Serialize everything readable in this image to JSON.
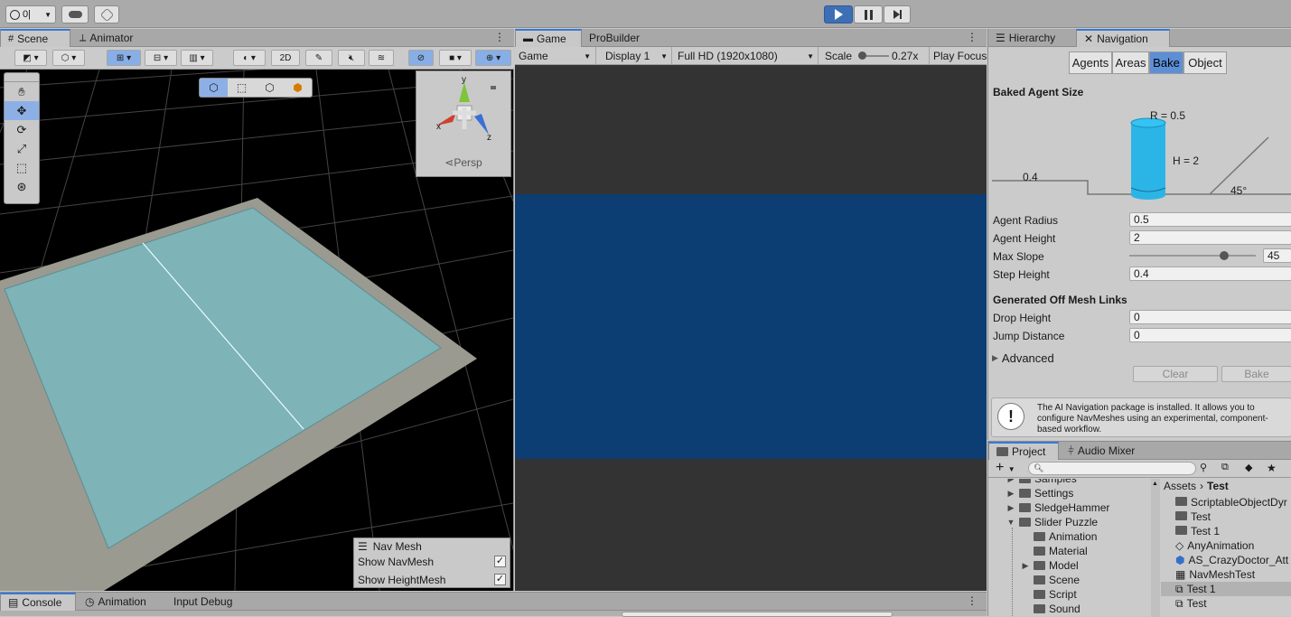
{
  "toolbar": {
    "account_label": "0|",
    "play_icon": "play-icon",
    "pause_icon": "pause-icon",
    "step_icon": "step-icon"
  },
  "scene_panel": {
    "tabs": [
      {
        "label": "Scene"
      },
      {
        "label": "Animator"
      }
    ],
    "toggle_2d": "2D",
    "gizmo": {
      "x": "x",
      "y": "y",
      "z": "z",
      "persp": "Persp"
    },
    "nav_overlay": {
      "title": "Nav Mesh",
      "show_navmesh": "Show NavMesh",
      "show_heightmesh": "Show HeightMesh",
      "navmesh_checked": true,
      "heightmesh_checked": true
    }
  },
  "game_panel": {
    "tabs": [
      {
        "label": "Game"
      },
      {
        "label": "ProBuilder"
      }
    ],
    "game_dropdown": "Game",
    "display_dropdown": "Display 1",
    "resolution_dropdown": "Full HD (1920x1080)",
    "scale_label": "Scale",
    "scale_value": "0.27x",
    "scale_fraction": 0.05,
    "play_focus": "Play Focus"
  },
  "nav_panel": {
    "tabs": [
      {
        "label": "Hierarchy"
      },
      {
        "label": "Navigation"
      }
    ],
    "subtabs": [
      "Agents",
      "Areas",
      "Bake",
      "Object"
    ],
    "active_subtab": "Bake",
    "baked_agent_size": "Baked Agent Size",
    "diagram": {
      "radius_label": "R = 0.5",
      "height_label": "H = 2",
      "step_label": "0.4",
      "slope_label": "45°"
    },
    "fields": {
      "agent_radius": {
        "label": "Agent Radius",
        "value": "0.5"
      },
      "agent_height": {
        "label": "Agent Height",
        "value": "2"
      },
      "max_slope": {
        "label": "Max Slope",
        "value": "45",
        "fraction": 0.75
      },
      "step_height": {
        "label": "Step Height",
        "value": "0.4"
      }
    },
    "off_mesh_title": "Generated Off Mesh Links",
    "drop_height": {
      "label": "Drop Height",
      "value": "0"
    },
    "jump_distance": {
      "label": "Jump Distance",
      "value": "0"
    },
    "advanced": "Advanced",
    "clear_button": "Clear",
    "bake_button": "Bake",
    "info_text": "The AI Navigation package is installed. It allows you to configure NavMeshes using an experimental, component-based workflow."
  },
  "project_panel": {
    "tabs": [
      {
        "label": "Project"
      },
      {
        "label": "Audio Mixer"
      }
    ],
    "tree": [
      {
        "label": "Samples",
        "indent": 0,
        "expand": "closed"
      },
      {
        "label": "Settings",
        "indent": 0,
        "expand": "closed"
      },
      {
        "label": "SledgeHammer",
        "indent": 0,
        "expand": "closed"
      },
      {
        "label": "Slider Puzzle",
        "indent": 0,
        "expand": "open"
      },
      {
        "label": "Animation",
        "indent": 1,
        "expand": "none"
      },
      {
        "label": "Material",
        "indent": 1,
        "expand": "none"
      },
      {
        "label": "Model",
        "indent": 1,
        "expand": "closed"
      },
      {
        "label": "Scene",
        "indent": 1,
        "expand": "none"
      },
      {
        "label": "Script",
        "indent": 1,
        "expand": "none"
      },
      {
        "label": "Sound",
        "indent": 1,
        "expand": "none"
      }
    ],
    "breadcrumb": {
      "root": "Assets",
      "current": "Test"
    },
    "assets": [
      {
        "label": "ScriptableObjectDyr",
        "icon": "folder-icon",
        "selected": false
      },
      {
        "label": "Test",
        "icon": "folder-icon",
        "selected": false
      },
      {
        "label": "Test 1",
        "icon": "folder-icon",
        "selected": false
      },
      {
        "label": "AnyAnimation",
        "icon": "animation-icon",
        "selected": false
      },
      {
        "label": "AS_CrazyDoctor_Att",
        "icon": "prefab-icon",
        "selected": false
      },
      {
        "label": "NavMeshTest",
        "icon": "scene-icon",
        "selected": false
      },
      {
        "label": "Test 1",
        "icon": "controller-icon",
        "selected": true
      },
      {
        "label": "Test",
        "icon": "controller-icon",
        "selected": false
      }
    ]
  },
  "bottom_panel": {
    "tabs": [
      {
        "label": "Console"
      },
      {
        "label": "Animation"
      },
      {
        "label": "Input Debug"
      }
    ]
  },
  "colors": {
    "accent": "#3a79d6",
    "navmesh": "#7eb3b8",
    "game_blue": "#0c3d73",
    "agent": "#2bb5e6"
  }
}
